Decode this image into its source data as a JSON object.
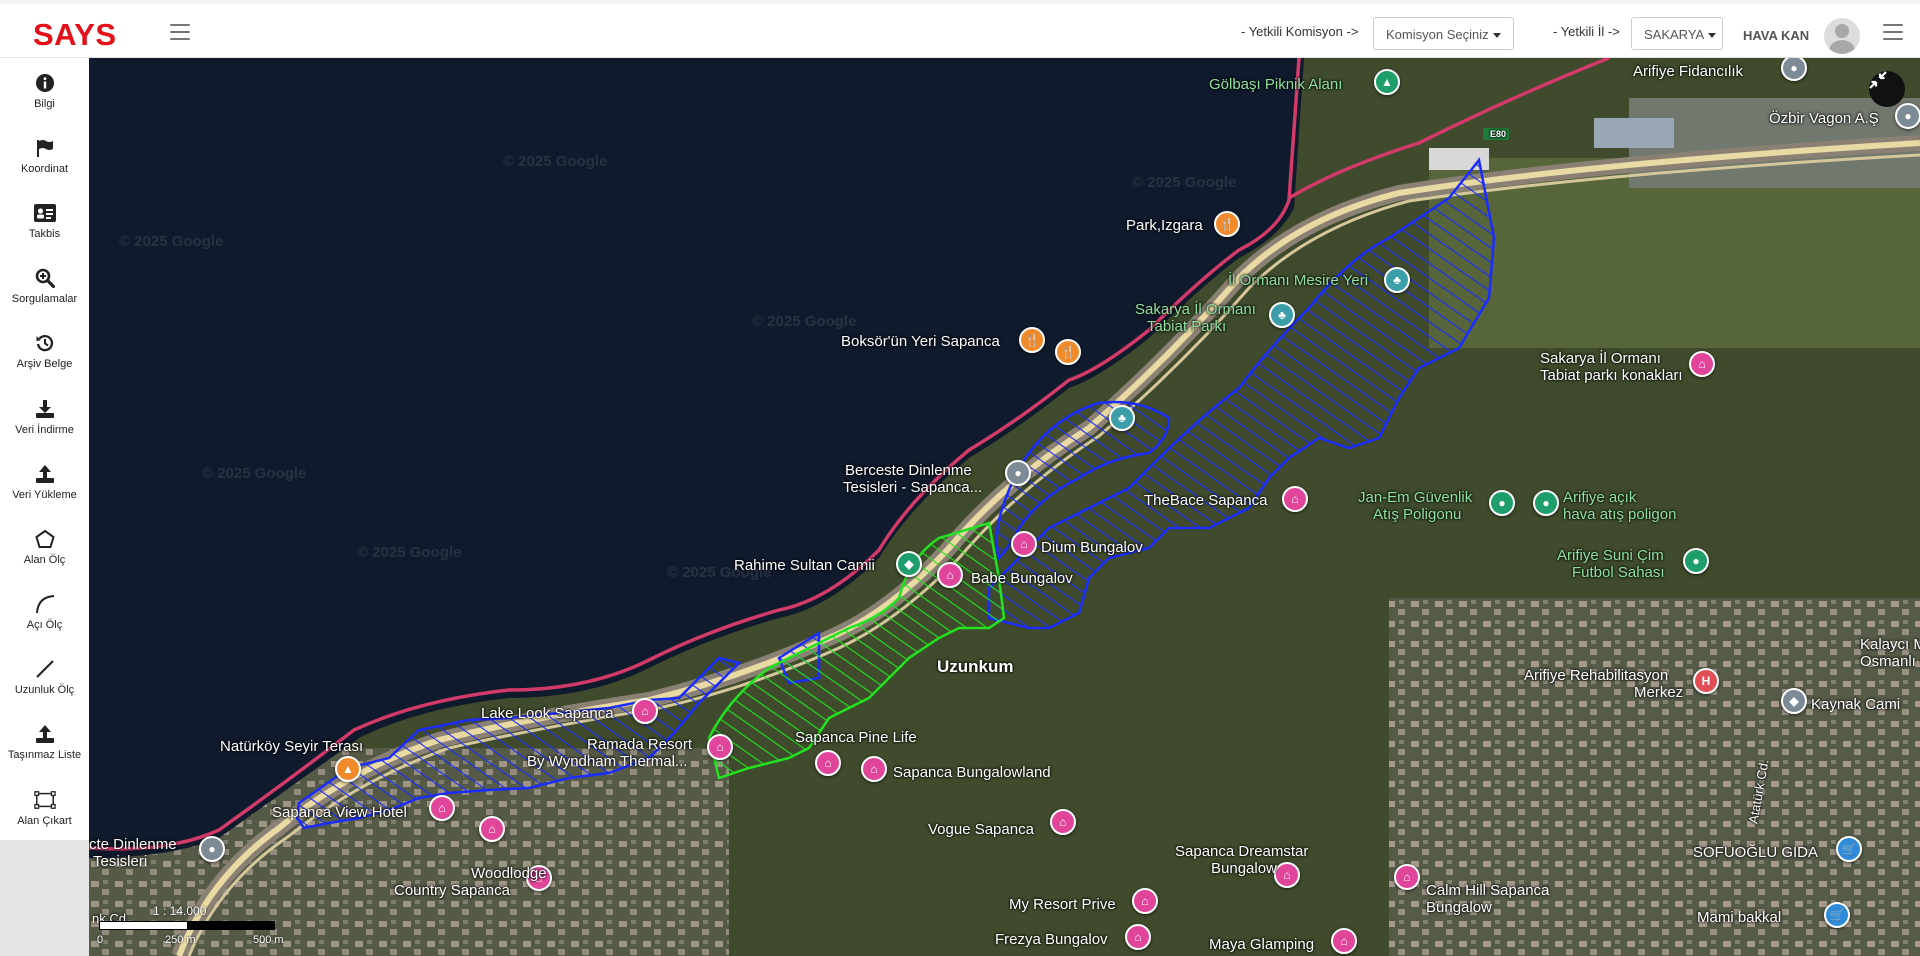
{
  "header": {
    "logo": "SAYS",
    "commission_label": "- Yetkili Komisyon ->",
    "commission_select": "Komisyon Seçiniz",
    "province_label": "- Yetkili İl ->",
    "province_select": "SAKARYA",
    "user_name": "HAVA KAN"
  },
  "sidebar": {
    "items": [
      {
        "label": "Bilgi",
        "icon": "info-icon"
      },
      {
        "label": "Koordinat",
        "icon": "flag-icon"
      },
      {
        "label": "Takbis",
        "icon": "id-card-icon"
      },
      {
        "label": "Sorgulamalar",
        "icon": "search-plus-icon"
      },
      {
        "label": "Arşiv Belge",
        "icon": "history-icon"
      },
      {
        "label": "Veri İndirme",
        "icon": "download-icon"
      },
      {
        "label": "Veri Yükleme",
        "icon": "upload-icon"
      },
      {
        "label": "Alan Ölç",
        "icon": "pentagon-icon"
      },
      {
        "label": "Açı Ölç",
        "icon": "arc-icon"
      },
      {
        "label": "Uzunluk Ölç",
        "icon": "line-icon"
      },
      {
        "label": "Taşınmaz Liste",
        "icon": "upload-list-icon"
      },
      {
        "label": "Alan Çıkart",
        "icon": "crop-area-icon"
      }
    ]
  },
  "map": {
    "watermark": "© 2025 Google",
    "road_shield": "E80",
    "labels": {
      "golbasi": "Gölbaşı Piknik Alanı",
      "arifiye_fidan": "Arifiye Fidancılık",
      "ozbir": "Özbir Vagon A.Ş",
      "park_izgara": "Park,Izgara",
      "il_ormani_mesire": "İl Ormanı Mesire Yeri",
      "sakarya_il_ormani_1": "Sakarya İl Ormanı",
      "sakarya_il_ormani_2": "Tabiat Parkı",
      "konaklari_1": "Sakarya İl Ormanı",
      "konaklari_2": "Tabiat parkı konakları",
      "boksor": "Boksör'ün Yeri Sapanca",
      "bercesle_1": "Berceste Dinlenme",
      "bercesle_2": "Tesisleri - Sapanca...",
      "thebace": "TheBace Sapanca",
      "janem_1": "Jan-Em Güvenlik",
      "janem_2": "Atış Poligonu",
      "arifiye_acik_1": "Arifiye açık",
      "arifiye_acik_2": "hava atış poligon",
      "dium": "Dium Bungalov",
      "rahime": "Rahime Sultan Camii",
      "babe": "Babe Bungalov",
      "arifiye_suni_1": "Arifiye Suni Çim",
      "arifiye_suni_2": "Futbol Sahası",
      "kalayci_1": "Kalaycı Mer",
      "kalayci_2": "Osmanlı Ca",
      "uzunkum": "Uzunkum",
      "arifiye_rehab_1": "Arifiye Rehabilitasyon",
      "arifiye_rehab_2": "Merkez",
      "kaynak": "Kaynak Cami",
      "lake_look": "Lake Look Sapanca",
      "naturkoy": "Natürköy Seyir Terası",
      "ramada_1": "Ramada Resort",
      "ramada_2": "By Wyndham Thermal...",
      "pine_life": "Sapanca Pine Life",
      "bungalowland": "Sapanca Bungalowland",
      "view_hotel": "Sapanca View Hotel",
      "ataturk": "Atatürk Cd.",
      "dinlenme_1": "cte Dinlenme",
      "dinlenme_2": "Tesisleri",
      "woodlodge_1": "Woodlodge",
      "woodlodge_2": "Country Sapanca",
      "vogue": "Vogue Sapanca",
      "dreamstar_1": "Sapanca Dreamstar",
      "dreamstar_2": "Bungalow",
      "calm_hill_1": "Calm Hill Sapanca",
      "calm_hill_2": "Bungalow",
      "sofuoglu": "SOFUOĞLU GIDA",
      "my_resort": "My Resort Prive",
      "mami": "Mami bakkal",
      "frezya": "Frezya Bungalov",
      "maya": "Maya Glamping",
      "street_cd": "nk Cd."
    },
    "scale": {
      "ratio": "1 : 14.000",
      "tick0": "0",
      "tick1": "250 m",
      "tick2": "500 m"
    },
    "layer_colors": {
      "lake": "#0f1a2c",
      "boundary": "#d23a6a",
      "blue_parcels": "#1a2cff",
      "green_parcels": "#23e21f",
      "road": "#e9d9a2"
    }
  }
}
